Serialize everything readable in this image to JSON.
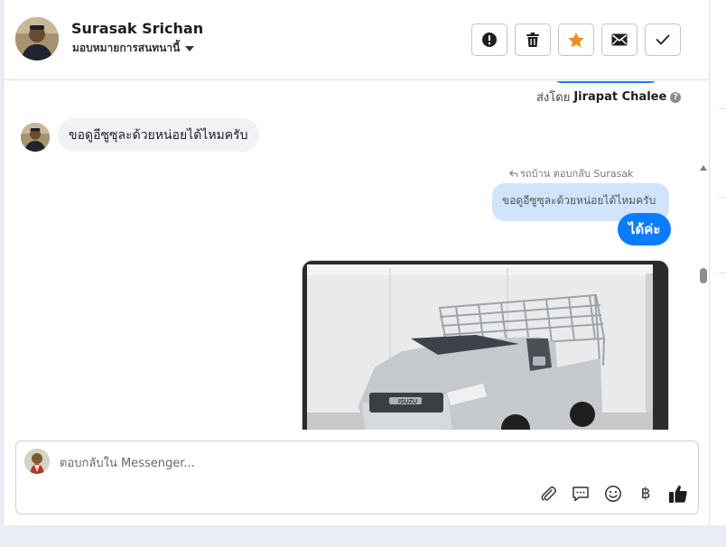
{
  "header": {
    "user_name": "Surasak Srichan",
    "assign_label": "มอบหมายการสนทนานี้",
    "actions": [
      {
        "name": "alert-icon"
      },
      {
        "name": "trash-icon"
      },
      {
        "name": "star-icon"
      },
      {
        "name": "envelope-icon"
      },
      {
        "name": "check-icon"
      }
    ]
  },
  "conversation": {
    "sent_by_prefix": "ส่งโดย",
    "sent_by_name": "Jirapat Chalee",
    "incoming_message": "ขอดูอีซูซุละด้วยหน่อยได้ไหมครับ",
    "reply_meta": "รถบ้าน ตอบกลับ Surasak",
    "quoted_message": "ขอดูอีซูซุละด้วยหน่อยได้ไหมครับ",
    "outgoing_message": "ได้ค่ะ",
    "image_badge": "ISUZU"
  },
  "composer": {
    "placeholder": "ตอบกลับใน Messenger...",
    "tools": [
      "paperclip-icon",
      "chat-icon",
      "smiley-icon",
      "baht-icon",
      "thumbs-up-icon"
    ],
    "currency_symbol": "฿"
  },
  "colors": {
    "accent": "#0a7cff",
    "star": "#f28b18",
    "quoted_bg": "#d0e4fc",
    "incoming_bg": "#f0f2f5"
  }
}
